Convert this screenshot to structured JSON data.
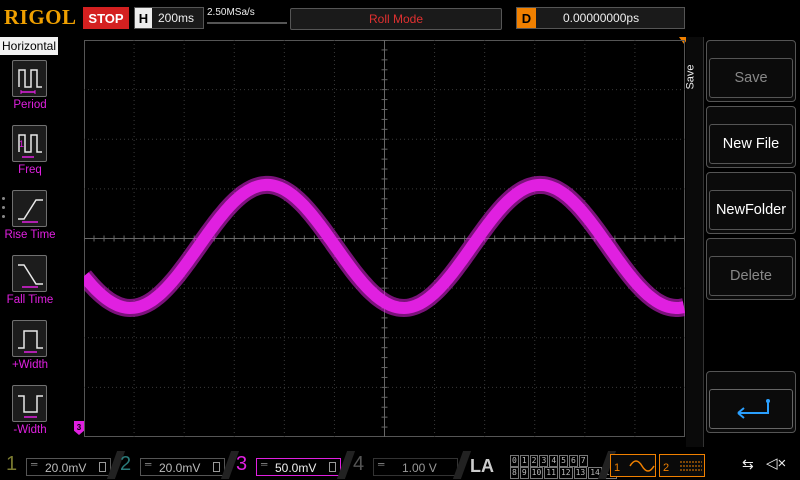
{
  "topbar": {
    "brand": "RIGOL",
    "run_state": "STOP",
    "timebase_key": "H",
    "timebase_value": "200ms",
    "sample_rate": "2.50MSa/s",
    "trigger_mode": "Roll Mode",
    "delay_key": "D",
    "delay_value": "0.00000000ps"
  },
  "left_panel": {
    "title": "Horizontal",
    "items": [
      {
        "label": "Period",
        "icon": "period-icon"
      },
      {
        "label": "Freq",
        "icon": "freq-icon"
      },
      {
        "label": "Rise Time",
        "icon": "rise-time-icon"
      },
      {
        "label": "Fall Time",
        "icon": "fall-time-icon"
      },
      {
        "label": "+Width",
        "icon": "pos-width-icon"
      },
      {
        "label": "-Width",
        "icon": "neg-width-icon"
      }
    ]
  },
  "right_menu": {
    "title": "Save",
    "buttons": [
      {
        "label": "Save",
        "enabled": false
      },
      {
        "label": "New File",
        "enabled": true
      },
      {
        "label": "NewFolder",
        "enabled": true
      },
      {
        "label": "Delete",
        "enabled": false
      }
    ],
    "back_icon": "return-arrow-icon"
  },
  "channels": [
    {
      "num": "1",
      "coupling": "DC",
      "scale": "20.0mV",
      "color": "#f0e000",
      "enabled": false
    },
    {
      "num": "2",
      "coupling": "DC",
      "scale": "20.0mV",
      "color": "#00e0e0",
      "enabled": false
    },
    {
      "num": "3",
      "coupling": "DC",
      "scale": "50.0mV",
      "color": "#e020e0",
      "enabled": true
    },
    {
      "num": "4",
      "coupling": "DC",
      "scale": "1.00 V",
      "color": "#3070ff",
      "enabled": false
    }
  ],
  "la": {
    "label": "LA",
    "row1": [
      "0",
      "1",
      "2",
      "3",
      "4",
      "5",
      "6",
      "7"
    ],
    "row2": [
      "8",
      "9",
      "10",
      "11",
      "12",
      "13",
      "14",
      "15"
    ]
  },
  "generators": [
    {
      "num": "1",
      "icon": "sine-wave-icon"
    },
    {
      "num": "2",
      "icon": "square-wave-icon"
    }
  ],
  "status_icons": [
    "usb-icon",
    "speaker-muted-icon"
  ],
  "channel_marker": "3",
  "waveform": {
    "channel": "3",
    "color": "#e020e0",
    "shape": "sine",
    "cycles_visible": 2.2
  }
}
